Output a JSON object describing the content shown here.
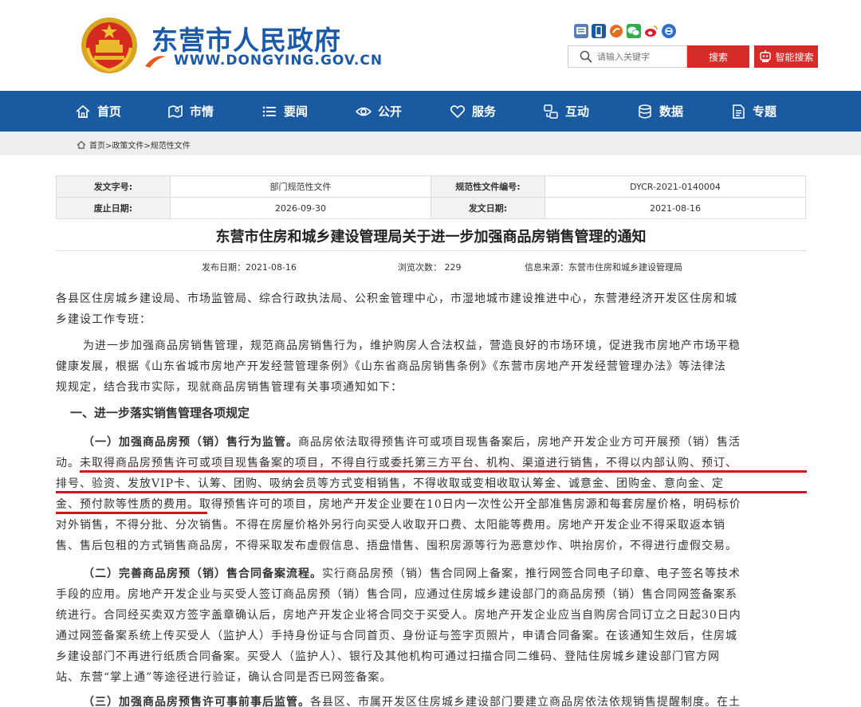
{
  "site": {
    "name": "东营市人民政府",
    "url": "WWW.DONGYING.GOV.CN",
    "search_placeholder": "请输入关键字",
    "search_label": "搜索",
    "smart_search_label": "智能搜索"
  },
  "nav": [
    "首页",
    "市情",
    "要闻",
    "公开",
    "服务",
    "互动",
    "数据",
    "专题"
  ],
  "breadcrumb": [
    "首页>",
    "政策文件>",
    "规范性文件"
  ],
  "meta": {
    "doc_no_label": "发文字号:",
    "doc_no_value": "部门规范性文件",
    "code_label": "规范性文件编号:",
    "code_value": "DYCR-2021-0140004",
    "expire_label": "废止日期:",
    "expire_value": "2026-09-30",
    "issue_label": "发文日期:",
    "issue_value": "2021-08-16"
  },
  "title": "东营市住房和城乡建设管理局关于进一步加强商品房销售管理的通知",
  "pub": {
    "date": "发布日期：2021-08-16",
    "views": "浏览次数： 229",
    "source": "信息来源：东营市住房和城乡建设管理局"
  },
  "body": {
    "p1": [
      "各县区住房城乡建设局、市场监管局、综合行政执法局、公积金管理中心，市湿地城市建设推进中心，东营港经济开发区住房和城",
      "乡建设工作专班："
    ],
    "p2": [
      "为进一步加强商品房销售管理，规范商品房销售行为，维护购房人合法权益，营造良好的市场环境，促进我市房地产市场平稳",
      "健康发展，根据《山东省城市房地产开发经营管理条例》《山东省商品房销售条例》《东营市房地产开发经营管理办法》等法律法",
      "规规定，结合我市实际，现就商品房销售管理有关事项通知如下："
    ],
    "section1": "一、进一步落实销售管理各项规定",
    "p3_heading": "（一）加强商品房预（销）售行为监管。",
    "p3": [
      "商品房依法取得预售许可或项目现售备案后，房地产开发企业方可开展预（销）售活",
      "动。未取得商品房预售许可或项目现售备案的项目，不得自行或委托第三方平台、机构、渠道进行销售，不得以内部认购、预订、",
      "排号、验资、发放VIP卡、认筹、团购、吸纳会员等方式变相销售，不得收取或变相收取认筹金、诚意金、团购金、意向金、定",
      "金、预付款等性质的费用。取得预售许可的项目，房地产开发企业要在10日内一次性公开全部准售房源和每套房屋价格，明码标价",
      "对外销售，不得分批、分次销售。不得在房屋价格外另行向买受人收取开口费、太阳能等费用。房地产开发企业不得采取返本销",
      "售、售后包租的方式销售商品房，不得采取发布虚假信息、捂盘惜售、囤积房源等行为恶意炒作、哄抬房价，不得进行虚假交易。"
    ],
    "p4_heading": "（二）完善商品房预（销）售合同备案流程。",
    "p4": [
      "实行商品房预（销）售合同网上备案，推行网签合同电子印章、电子签名等技术",
      "手段的应用。房地产开发企业与买受人签订商品房预（销）售合同，应通过住房城乡建设部门的商品房预（销）售合同网签备案系",
      "统进行。合同经买卖双方签字盖章确认后，房地产开发企业将合同交于买受人。房地产开发企业应当自购房合同订立之日起30日内",
      "通过网签备案系统上传买受人（监护人）手持身份证与合同首页、身份证与签字页照片，申请合同备案。在该通知生效后，住房城",
      "乡建设部门不再进行纸质合同备案。买受人（监护人）、银行及其他机构可通过扫描合同二维码、登陆住房城乡建设部门官方网",
      "站、东营“掌上通”等途径进行验证，确认合同是否已网签备案。"
    ],
    "p5_heading": "（三）加强商品房预售许可事前事后监管。",
    "p5": [
      "各县区、市属开发区住房城乡建设部门要建立商品房依法依规销售提醒制度。在土"
    ]
  },
  "colors": {
    "brand_blue": "#1a5aa0",
    "search_red": "#d62b28",
    "highlight_red": "#d8141b"
  }
}
